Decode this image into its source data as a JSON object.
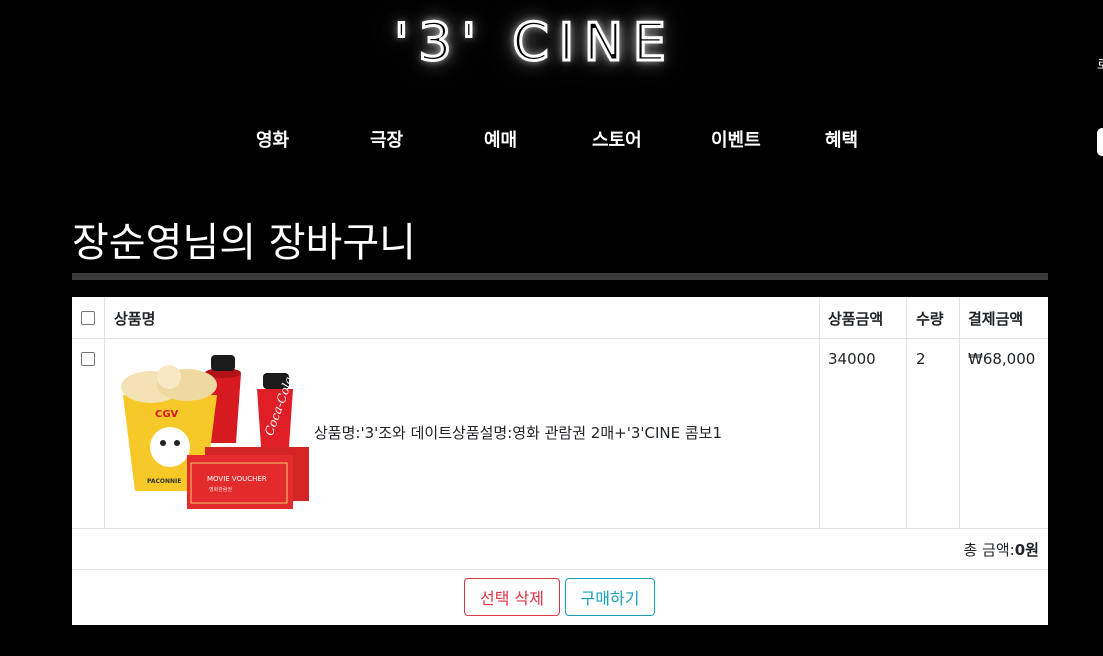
{
  "logo": {
    "text": "'3' CINE"
  },
  "nav": {
    "items": [
      {
        "label": "영화"
      },
      {
        "label": "극장"
      },
      {
        "label": "예매"
      },
      {
        "label": "스토어"
      },
      {
        "label": "이벤트"
      },
      {
        "label": "혜택"
      }
    ]
  },
  "edge": {
    "glyph": "로"
  },
  "page": {
    "title": "장순영님의 장바구니"
  },
  "cart": {
    "headers": {
      "product": "상품명",
      "price": "상품금액",
      "qty": "수량",
      "payment": "결제금액"
    },
    "rows": [
      {
        "description": "상품명:'3'조와 데이트상품설명:영화 관람권 2매+'3'CINE 콤보1",
        "price": "34000",
        "qty": "2",
        "payment": "₩68,000",
        "image": {
          "icon": "popcorn-combo-image",
          "brand": "CGV",
          "bucket_label": "PACONNIE",
          "voucher_text": "MOVIE VOUCHER",
          "voucher_sub": "영화관람권",
          "can_text": "Coca-Cola"
        }
      }
    ],
    "total_label": "총 금액:",
    "total_value": "0원",
    "delete_button": "선택 삭제",
    "purchase_button": "구매하기"
  },
  "colors": {
    "background": "#000000",
    "delete_red": "#dc3545",
    "purchase_cyan": "#17a2b8",
    "rule": "#3a3a3a"
  }
}
